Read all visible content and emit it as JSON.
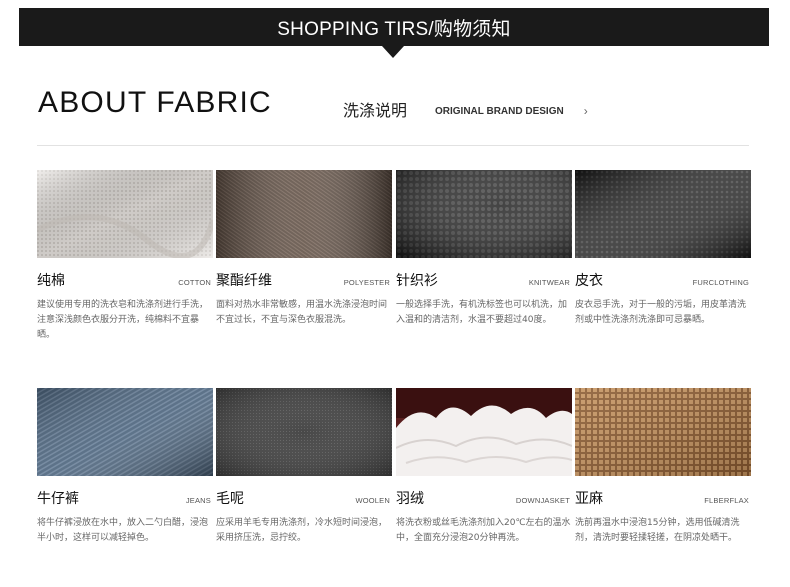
{
  "banner": {
    "title": "SHOPPING TIRS/购物须知"
  },
  "header": {
    "title": "ABOUT FABRIC",
    "wash_label": "洗涤说明",
    "brand_link": "ORIGINAL BRAND DESIGN"
  },
  "fabrics": [
    {
      "cn": "纯棉",
      "en": "COTTON",
      "desc": "建议使用专用的洗衣皂和洗涤剂进行手洗，注意深浅颜色衣服分开洗，纯棉料不宜暴晒。"
    },
    {
      "cn": "聚酯纤维",
      "en": "POLYESTER",
      "desc": "面料对热水非常敏感，用温水洗涤浸泡时间不宜过长，不宜与深色衣服混洗。"
    },
    {
      "cn": "针织衫",
      "en": "KNITWEAR",
      "desc": "一般选择手洗，有机洗标签也可以机洗，加入温和的清洁剂，水温不要超过40度。"
    },
    {
      "cn": "皮衣",
      "en": "FURCLOTHING",
      "desc": "皮衣忌手洗，对于一般的污垢，用皮革清洗剂或中性洗涤剂洗涤即可忌暴晒。"
    },
    {
      "cn": "牛仔裤",
      "en": "JEANS",
      "desc": "将牛仔裤浸放在水中，放入二勺白醋，浸泡半小时，这样可以减轻掉色。"
    },
    {
      "cn": "毛呢",
      "en": "WOOLEN",
      "desc": "应采用羊毛专用洗涤剂，冷水短时间浸泡，采用挤压洗，忌拧绞。"
    },
    {
      "cn": "羽绒",
      "en": "DOWNJASKET",
      "desc": "将洗衣粉或丝毛洗涤剂加入20℃左右的温水中，全面充分浸泡20分钟再洗。"
    },
    {
      "cn": "亚麻",
      "en": "FLBERFLAX",
      "desc": "洗前再温水中浸泡15分钟，选用低碱清洗剂，清洗时要轻揉轻搓，在阴凉处晒干。"
    }
  ],
  "colors": {
    "banner_bg": "#1a1a1a",
    "cotton": "#dcd8d3",
    "polyester": "#5a4a3f",
    "knitwear": "#2b2b2b",
    "leather": "#1e1e1e",
    "jeans": "#48607a",
    "woolen": "#3a3a3a",
    "down": "#f2efee",
    "linen": "#b88654"
  }
}
